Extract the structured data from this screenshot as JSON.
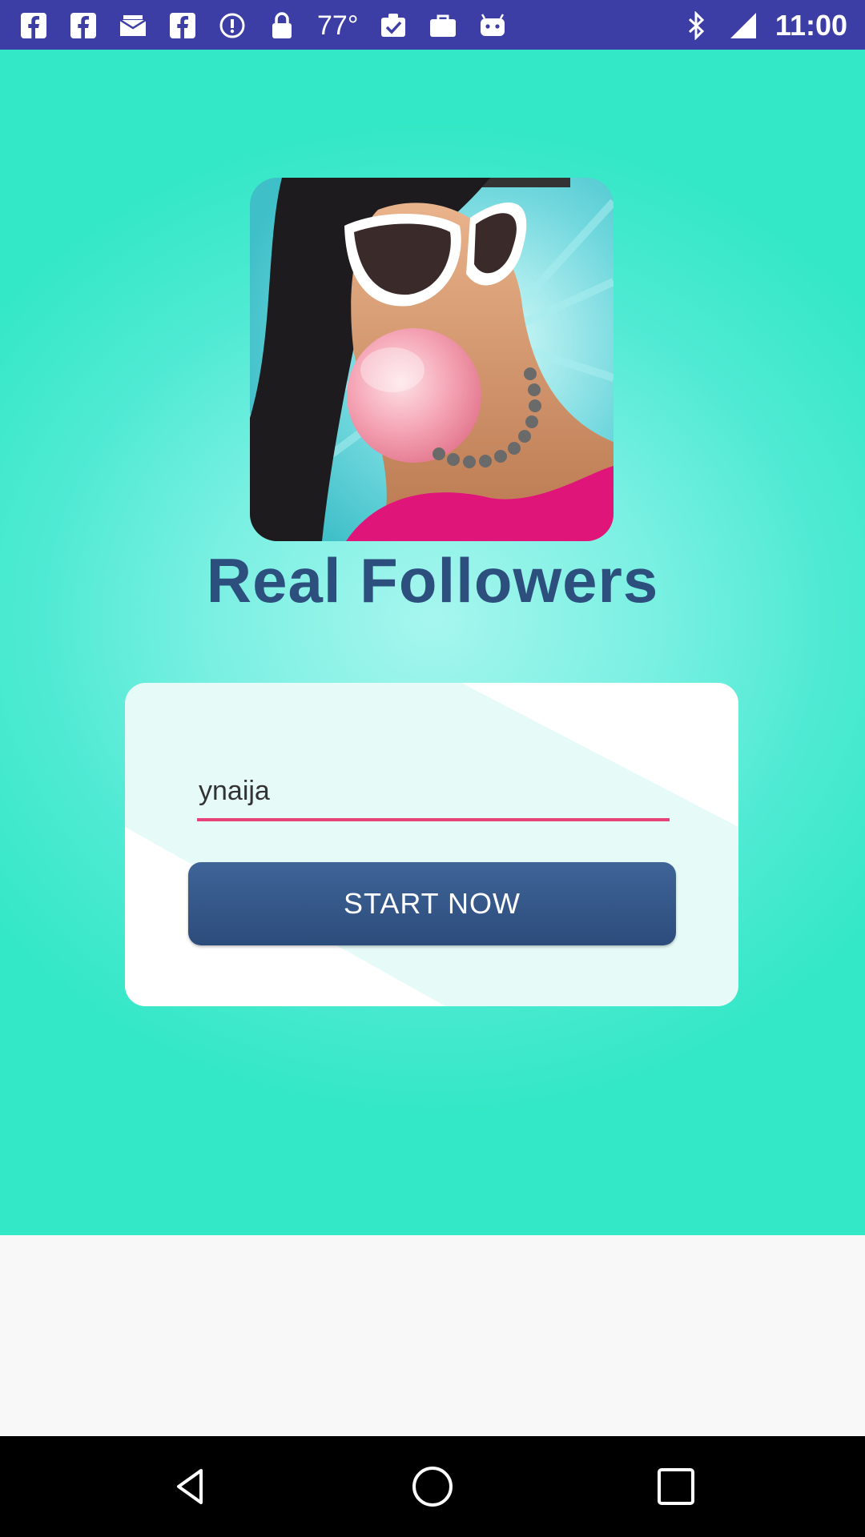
{
  "status_bar": {
    "left_icons": [
      "facebook-icon",
      "facebook-icon",
      "mail-icon",
      "facebook-icon",
      "info-icon",
      "lock-icon"
    ],
    "temperature": "77°",
    "right_icons": [
      "clipboard-check-icon",
      "briefcase-icon",
      "android-icon",
      "bluetooth-icon",
      "signal-icon"
    ],
    "time": "11:00"
  },
  "app": {
    "title": "Real Followers",
    "username_value": "ynaija",
    "start_label": "START NOW",
    "logo_icon": "bubblegum-girl-logo"
  },
  "colors": {
    "status_bar": "#3c3ea6",
    "title": "#2c4f7e",
    "button": "#345783",
    "underline": "#e9417a",
    "background": "#4fead3"
  },
  "nav_bar": {
    "icons": [
      "back-icon",
      "home-icon",
      "recents-icon"
    ]
  }
}
